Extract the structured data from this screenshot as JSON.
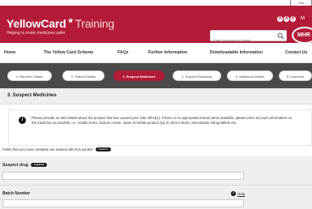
{
  "topbar": {
    "corner_label": "Sea"
  },
  "header": {
    "brand_main": "YellowCard",
    "brand_sub": "Training",
    "tagline": "Helping to make medicines safer",
    "a11y_buttons": [
      "A",
      "A",
      "A"
    ],
    "a11y_extra": "M",
    "search_placeholder": "Enter Keywords to Search",
    "org_logo": "MHR"
  },
  "nav": {
    "items": [
      "Home",
      "The Yellow Card Scheme",
      "FAQs",
      "Further Information",
      "Downloadable Information",
      "Contact Us"
    ]
  },
  "steps": {
    "items": [
      "1. Reporter Details",
      "2. Patient Details",
      "3. Suspect Medicines",
      "4. Suspect Reactions",
      "5. Additional Details",
      "6. Overview"
    ],
    "active_index": 2
  },
  "section": {
    "title": "3. Suspect Medicines"
  },
  "info": {
    "text": "Please provide us with details about the product that has caused your side effect(s). If there is no appropriate brand name available, please enter as much information on the medicine as possible. i.e. Anadin Extra, Zovirax cream, name of herbal product (eg St John's Wort), Simvastatin 10mg tablets etc."
  },
  "required_note": {
    "text": "Fields that you must complete are marked with this symbol",
    "badge": "required"
  },
  "fields": {
    "suspect_drug": {
      "label": "Suspect drug",
      "badge": "required",
      "value": ""
    },
    "batch_number": {
      "label": "Batch Number",
      "value": "",
      "help": "Help"
    }
  },
  "colors": {
    "brand": "#b31b38",
    "steps_bg": "#4a4a4a",
    "panel_bg": "#efefef"
  }
}
